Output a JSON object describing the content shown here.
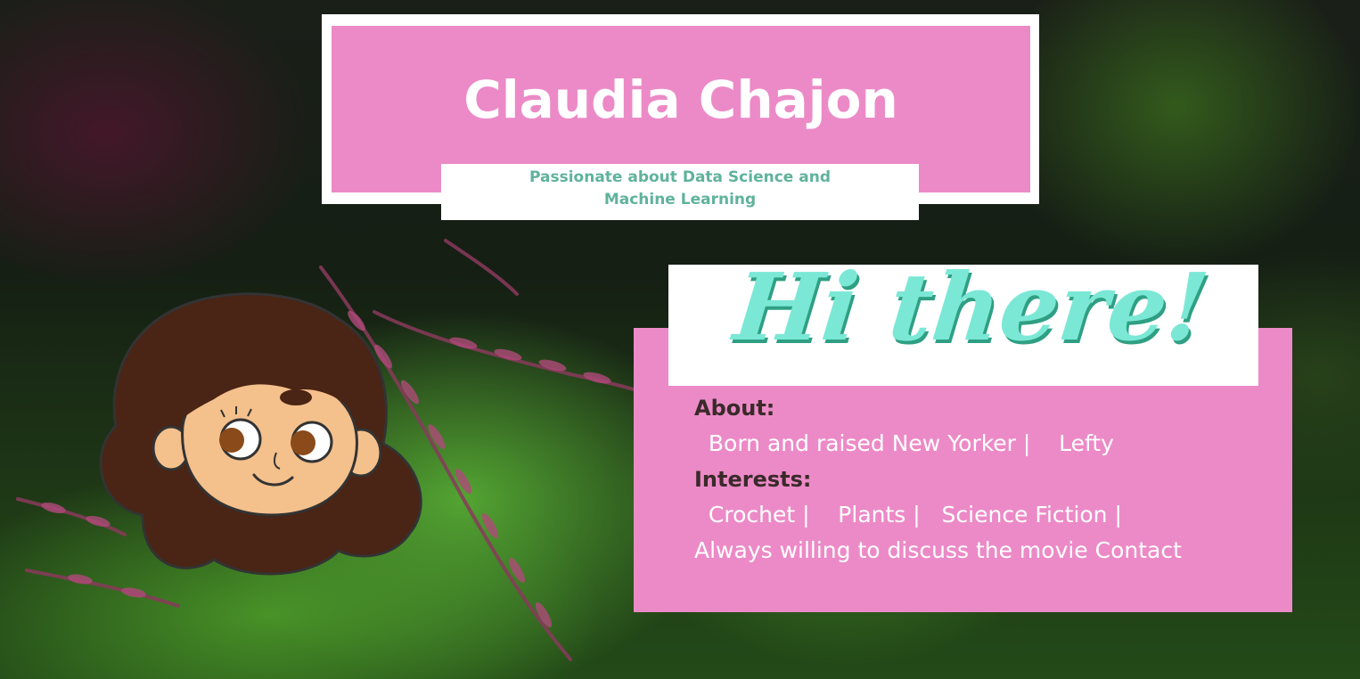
{
  "profile": {
    "name": "Claudia Chajon",
    "tagline_line1": "Passionate about Data Science and",
    "tagline_line2": "Machine Learning"
  },
  "greeting": "Hi there!",
  "about": {
    "heading": "About:",
    "text": "  Born and raised New Yorker |    Lefty"
  },
  "interests": {
    "heading": "Interests:",
    "text_line1": "  Crochet |    Plants |   Science Fiction |",
    "text_line2": "Always willing to discuss the movie Contact"
  },
  "colors": {
    "pink": "#ec8ac7",
    "mint": "#7be8d6",
    "teal_text": "#5fb39a",
    "white": "#ffffff",
    "hair": "#4a2414",
    "skin": "#f4c08c"
  },
  "icons": {
    "avatar": "cartoon-girl-avatar-icon"
  }
}
